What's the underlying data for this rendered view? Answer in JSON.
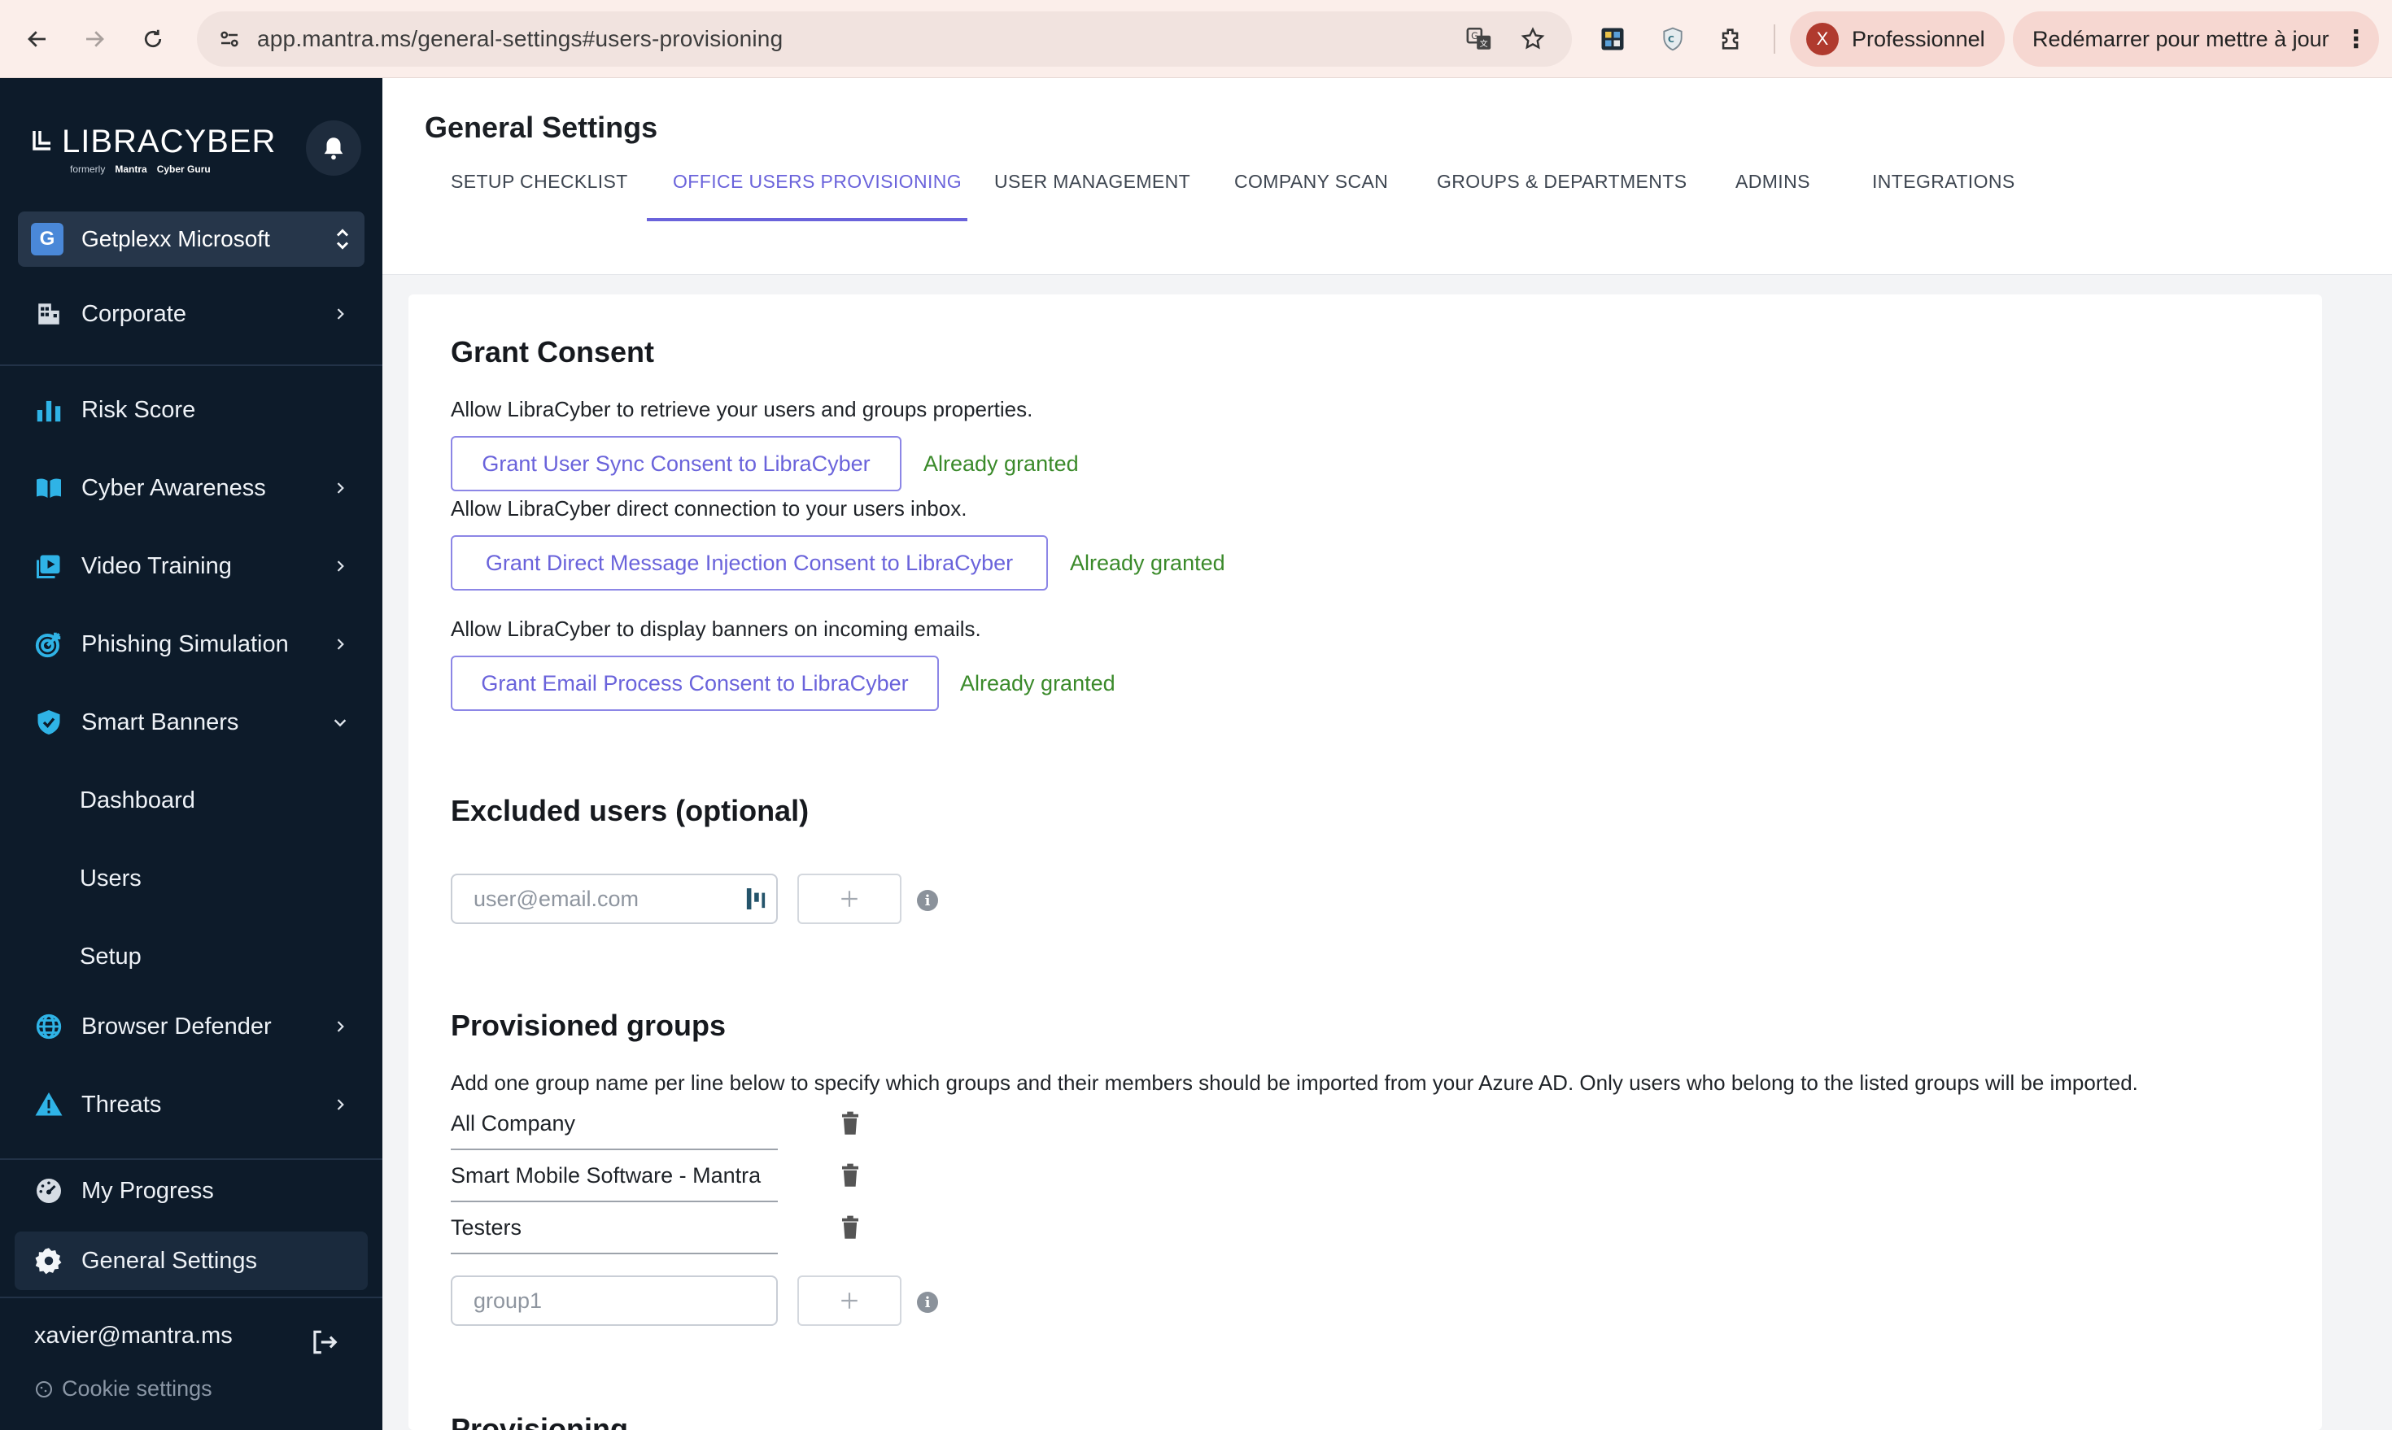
{
  "browser": {
    "url": "app.mantra.ms/general-settings#users-provisioning",
    "profile_initial": "X",
    "profile_label": "Professionnel",
    "update_label": "Redémarrer pour mettre à jour"
  },
  "sidebar": {
    "logo_text": "LIBRACYBER",
    "logo_formerly": "formerly",
    "logo_mantra": "Mantra",
    "logo_cyberguru": "Cyber Guru",
    "workspace_initial": "G",
    "workspace_name": "Getplexx Microsoft",
    "items": [
      {
        "label": "Corporate",
        "icon": "building-icon"
      },
      {
        "label": "Risk Score",
        "icon": "bar-chart-icon"
      },
      {
        "label": "Cyber Awareness",
        "icon": "book-icon"
      },
      {
        "label": "Video Training",
        "icon": "video-icon"
      },
      {
        "label": "Phishing Simulation",
        "icon": "target-icon"
      },
      {
        "label": "Smart Banners",
        "icon": "shield-icon"
      },
      {
        "label": "Dashboard"
      },
      {
        "label": "Users"
      },
      {
        "label": "Setup"
      },
      {
        "label": "Browser Defender",
        "icon": "globe-icon"
      },
      {
        "label": "Threats",
        "icon": "warning-icon"
      },
      {
        "label": "My Progress",
        "icon": "gauge-icon"
      },
      {
        "label": "General Settings",
        "icon": "gear-icon"
      }
    ],
    "user_email": "xavier@mantra.ms",
    "cookie_settings": "Cookie settings"
  },
  "header": {
    "title": "General Settings",
    "tabs": [
      {
        "label": "SETUP CHECKLIST"
      },
      {
        "label": "OFFICE USERS PROVISIONING",
        "active": true
      },
      {
        "label": "USER MANAGEMENT"
      },
      {
        "label": "COMPANY SCAN"
      },
      {
        "label": "GROUPS & DEPARTMENTS"
      },
      {
        "label": "ADMINS"
      },
      {
        "label": "INTEGRATIONS"
      }
    ]
  },
  "consent": {
    "title": "Grant Consent",
    "rows": [
      {
        "desc": "Allow LibraCyber to retrieve your users and groups properties.",
        "button": "Grant User Sync Consent to LibraCyber",
        "status": "Already granted"
      },
      {
        "desc": "Allow LibraCyber direct connection to your users inbox.",
        "button": "Grant Direct Message Injection Consent to LibraCyber",
        "status": "Already granted"
      },
      {
        "desc": "Allow LibraCyber to display banners on incoming emails.",
        "button": "Grant Email Process Consent to LibraCyber",
        "status": "Already granted"
      }
    ]
  },
  "excluded": {
    "title": "Excluded users (optional)",
    "placeholder": "user@email.com"
  },
  "groups": {
    "title": "Provisioned groups",
    "desc": "Add one group name per line below to specify which groups and their members should be imported from your Azure AD. Only users who belong to the listed groups will be imported.",
    "items": [
      "All Company",
      "Smart Mobile Software - Mantra",
      "Testers"
    ],
    "placeholder": "group1"
  },
  "provisioning": {
    "title": "Provisioning"
  },
  "colors": {
    "accent": "#6a63db",
    "granted": "#3a8a2a",
    "sidebar_bg": "#0d1b2a",
    "sidebar_icon": "#2fb3e6"
  }
}
